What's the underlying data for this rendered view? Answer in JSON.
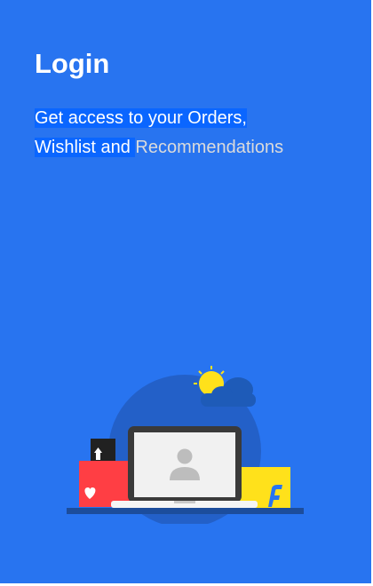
{
  "login": {
    "title": "Login",
    "subtitle_line1": "Get access to your Orders,",
    "subtitle_line2_highlighted": "Wishlist and ",
    "subtitle_line2_rest": "Recommendations"
  },
  "illustration": {
    "icons": [
      "sun-icon",
      "cloud-icon",
      "laptop-icon",
      "user-icon",
      "heart-icon",
      "upload-icon",
      "flipkart-f-icon"
    ],
    "colors": {
      "background": "#2874f0",
      "bag_red": "#ff3e44",
      "bag_yellow": "#ffe11b",
      "sun": "#ffe11b"
    }
  }
}
